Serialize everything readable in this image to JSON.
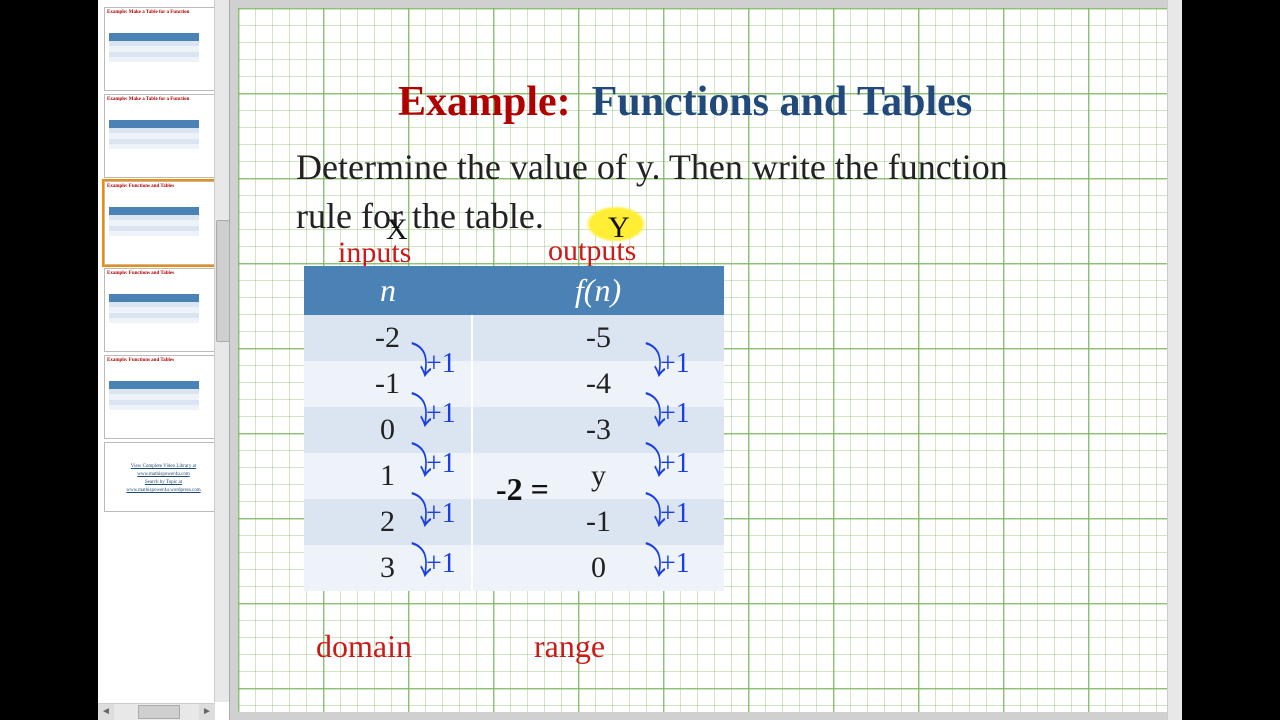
{
  "title": {
    "example_label": "Example:",
    "heading": "Functions and Tables"
  },
  "instruction": "Determine the value of y.  Then write the function rule for the table.",
  "annotations": {
    "x_label": "X",
    "y_label": "Y",
    "inputs": "inputs",
    "outputs": "outputs",
    "domain": "domain",
    "range": "range",
    "step": "+1",
    "y_equation_lhs": "-2 ="
  },
  "table": {
    "header_n": "n",
    "header_fn": "f(n)",
    "rows": [
      {
        "n": "-2",
        "fn": "-5"
      },
      {
        "n": "-1",
        "fn": "-4"
      },
      {
        "n": "0",
        "fn": "-3"
      },
      {
        "n": "1",
        "fn": "y"
      },
      {
        "n": "2",
        "fn": "-1"
      },
      {
        "n": "3",
        "fn": "0"
      }
    ]
  },
  "thumbs": {
    "items": [
      {
        "title": "Example: Make a Table for a Function"
      },
      {
        "title": "Example: Make a Table for a Function"
      },
      {
        "title": "Example: Functions and Tables"
      },
      {
        "title": "Example: Functions and Tables"
      },
      {
        "title": "Example: Functions and Tables"
      },
      {
        "title": "View Complete Video Library at"
      }
    ],
    "link1": "www.mathispower4u.com",
    "link2_label": "Search by Topic at",
    "link2": "www.mathispower4u.wordpress.com"
  }
}
